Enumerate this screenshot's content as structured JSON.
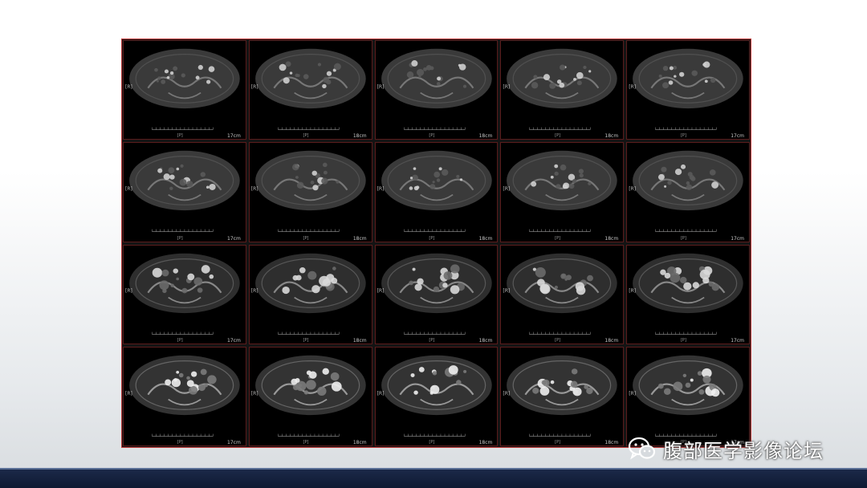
{
  "watermark": {
    "icon": "wechat-icon",
    "text": "腹部医学影像论坛"
  },
  "colors": {
    "frame_border": "#c23a3a",
    "bottom_bar": "#0f1a33"
  },
  "rows": [
    {
      "tone": "dark",
      "cells": [
        {
          "side": "[R]",
          "bottom": "[P]",
          "scale": "17cm"
        },
        {
          "side": "[R]",
          "bottom": "[P]",
          "scale": "18cm"
        },
        {
          "side": "[R]",
          "bottom": "[P]",
          "scale": "18cm"
        },
        {
          "side": "[R]",
          "bottom": "[P]",
          "scale": "18cm"
        },
        {
          "side": "[R]",
          "bottom": "[P]",
          "scale": "17cm"
        }
      ]
    },
    {
      "tone": "dark",
      "cells": [
        {
          "side": "[R]",
          "bottom": "[P]",
          "scale": "17cm"
        },
        {
          "side": "[R]",
          "bottom": "[P]",
          "scale": "18cm"
        },
        {
          "side": "[R]",
          "bottom": "[P]",
          "scale": "18cm"
        },
        {
          "side": "[R]",
          "bottom": "[P]",
          "scale": "18cm"
        },
        {
          "side": "[R]",
          "bottom": "[P]",
          "scale": "17cm"
        }
      ]
    },
    {
      "tone": "mid",
      "cells": [
        {
          "side": "[R]",
          "bottom": "[P]",
          "scale": "17cm"
        },
        {
          "side": "[R]",
          "bottom": "[P]",
          "scale": "18cm"
        },
        {
          "side": "[R]",
          "bottom": "[P]",
          "scale": "18cm"
        },
        {
          "side": "[R]",
          "bottom": "[P]",
          "scale": "18cm"
        },
        {
          "side": "[R]",
          "bottom": "[P]",
          "scale": "17cm"
        }
      ]
    },
    {
      "tone": "bright",
      "cells": [
        {
          "side": "[R]",
          "bottom": "[P]",
          "scale": "17cm"
        },
        {
          "side": "[R]",
          "bottom": "[P]",
          "scale": "18cm"
        },
        {
          "side": "[R]",
          "bottom": "[P]",
          "scale": "18cm"
        },
        {
          "side": "[R]",
          "bottom": "[P]",
          "scale": "18cm"
        },
        {
          "side": "[R]",
          "bottom": "[P]",
          "scale": "17cm"
        }
      ]
    }
  ]
}
